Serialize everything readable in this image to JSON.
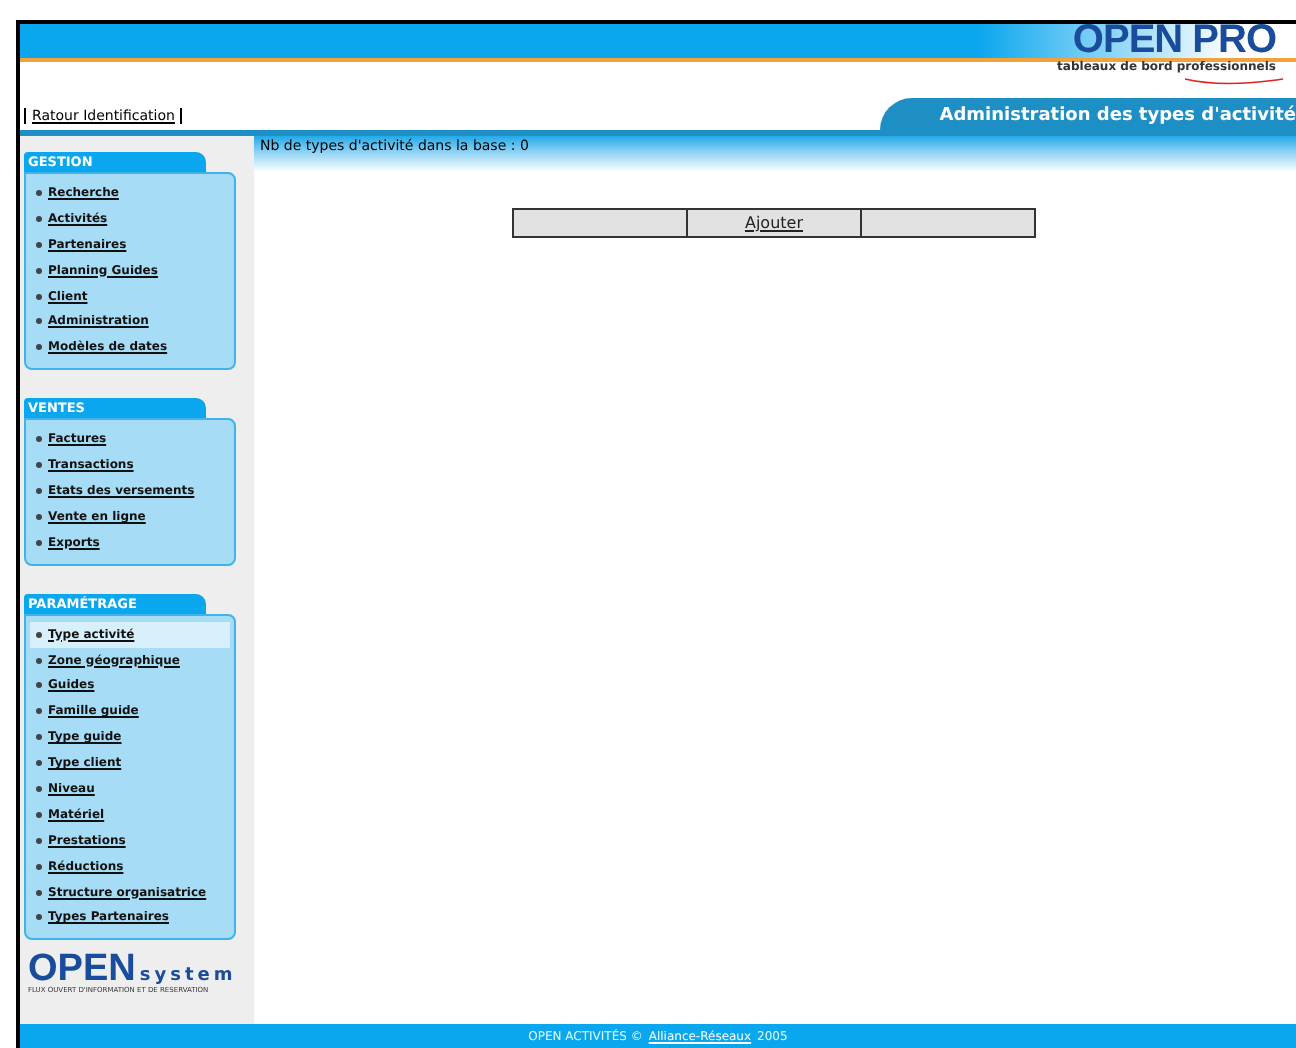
{
  "header": {
    "logo_title": "OPEN PRO",
    "logo_tagline": "tableaux de bord professionnels",
    "back_link": "Ratour Identification",
    "page_title": "Administration des types d'activité"
  },
  "sidebar": {
    "sections": [
      {
        "title": "GESTION",
        "items": [
          {
            "label": "Recherche",
            "selected": false
          },
          {
            "label": "Activités",
            "selected": false
          },
          {
            "label": "Partenaires",
            "selected": false
          },
          {
            "label": "Planning Guides",
            "selected": false
          },
          {
            "label": "Client",
            "selected": false
          },
          {
            "label": "Administration",
            "selected": false
          },
          {
            "label": "Modèles de dates",
            "selected": false
          }
        ]
      },
      {
        "title": "VENTES",
        "items": [
          {
            "label": "Factures",
            "selected": false
          },
          {
            "label": "Transactions",
            "selected": false
          },
          {
            "label": "Etats des versements",
            "selected": false
          },
          {
            "label": "Vente en ligne",
            "selected": false
          },
          {
            "label": "Exports",
            "selected": false
          }
        ]
      },
      {
        "title": "PARAMÉTRAGE",
        "items": [
          {
            "label": "Type activité",
            "selected": true
          },
          {
            "label": "Zone géographique",
            "selected": false
          },
          {
            "label": "Guides",
            "selected": false
          },
          {
            "label": "Famille guide",
            "selected": false
          },
          {
            "label": "Type guide",
            "selected": false
          },
          {
            "label": "Type client",
            "selected": false
          },
          {
            "label": "Niveau",
            "selected": false
          },
          {
            "label": "Matériel",
            "selected": false
          },
          {
            "label": "Prestations",
            "selected": false
          },
          {
            "label": "Réductions",
            "selected": false
          },
          {
            "label": "Structure organisatrice",
            "selected": false
          },
          {
            "label": "Types Partenaires",
            "selected": false
          }
        ]
      }
    ],
    "brand": "OPEN",
    "brand_suffix": "system",
    "brand_tagline": "FLUX OUVERT D'INFORMATION ET DE RESERVATION"
  },
  "main": {
    "count_text": "Nb de types d'activité dans la base : 0",
    "add_button": "Ajouter"
  },
  "footer": {
    "text_before": "OPEN ACTIVITÉS ©",
    "link": "Alliance-Réseaux",
    "text_after": "2005"
  }
}
